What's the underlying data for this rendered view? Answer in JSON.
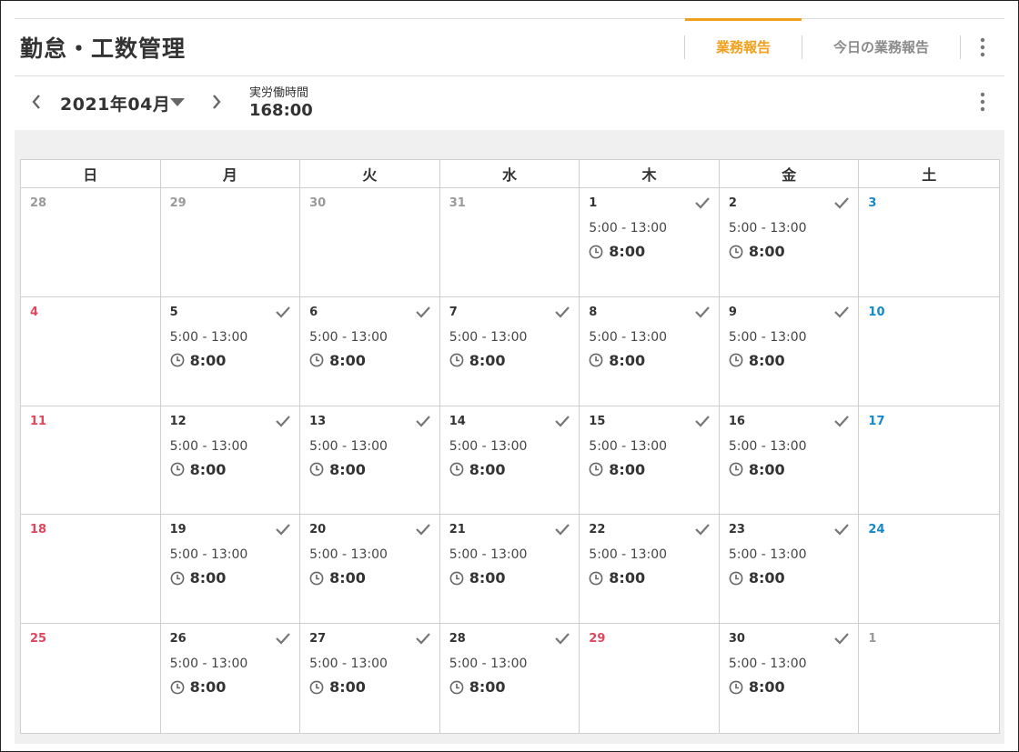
{
  "app": {
    "title": "勤怠・工数管理",
    "tabs": [
      {
        "label": "業務報告",
        "active": true
      },
      {
        "label": "今日の業務報告",
        "active": false
      }
    ]
  },
  "colors": {
    "accent": "#f2a01b",
    "sunday": "#e0465e",
    "saturday": "#1589c7",
    "other_month": "#9a9a9a"
  },
  "toolbar": {
    "month_label": "2021年04月",
    "worked_label": "実労働時間",
    "worked_value": "168:00"
  },
  "icons": {
    "prev": "chevron-left-icon",
    "next": "chevron-right-icon",
    "dropdown": "caret-down-icon",
    "more": "more-vertical-icon",
    "check": "check-icon",
    "clock": "clock-icon"
  },
  "calendar": {
    "weekdays": [
      "日",
      "月",
      "火",
      "水",
      "木",
      "金",
      "土"
    ],
    "days": [
      {
        "day": "28",
        "type": "other"
      },
      {
        "day": "29",
        "type": "other"
      },
      {
        "day": "30",
        "type": "other"
      },
      {
        "day": "31",
        "type": "other"
      },
      {
        "day": "1",
        "type": "cur",
        "done": true,
        "range": "5:00 - 13:00",
        "duration": "8:00"
      },
      {
        "day": "2",
        "type": "cur",
        "done": true,
        "range": "5:00 - 13:00",
        "duration": "8:00"
      },
      {
        "day": "3",
        "type": "sat"
      },
      {
        "day": "4",
        "type": "sun"
      },
      {
        "day": "5",
        "type": "cur",
        "done": true,
        "range": "5:00 - 13:00",
        "duration": "8:00"
      },
      {
        "day": "6",
        "type": "cur",
        "done": true,
        "range": "5:00 - 13:00",
        "duration": "8:00"
      },
      {
        "day": "7",
        "type": "cur",
        "done": true,
        "range": "5:00 - 13:00",
        "duration": "8:00"
      },
      {
        "day": "8",
        "type": "cur",
        "done": true,
        "range": "5:00 - 13:00",
        "duration": "8:00"
      },
      {
        "day": "9",
        "type": "cur",
        "done": true,
        "range": "5:00 - 13:00",
        "duration": "8:00"
      },
      {
        "day": "10",
        "type": "sat"
      },
      {
        "day": "11",
        "type": "sun"
      },
      {
        "day": "12",
        "type": "cur",
        "done": true,
        "range": "5:00 - 13:00",
        "duration": "8:00"
      },
      {
        "day": "13",
        "type": "cur",
        "done": true,
        "range": "5:00 - 13:00",
        "duration": "8:00"
      },
      {
        "day": "14",
        "type": "cur",
        "done": true,
        "range": "5:00 - 13:00",
        "duration": "8:00"
      },
      {
        "day": "15",
        "type": "cur",
        "done": true,
        "range": "5:00 - 13:00",
        "duration": "8:00"
      },
      {
        "day": "16",
        "type": "cur",
        "done": true,
        "range": "5:00 - 13:00",
        "duration": "8:00"
      },
      {
        "day": "17",
        "type": "sat"
      },
      {
        "day": "18",
        "type": "sun"
      },
      {
        "day": "19",
        "type": "cur",
        "done": true,
        "range": "5:00 - 13:00",
        "duration": "8:00"
      },
      {
        "day": "20",
        "type": "cur",
        "done": true,
        "range": "5:00 - 13:00",
        "duration": "8:00"
      },
      {
        "day": "21",
        "type": "cur",
        "done": true,
        "range": "5:00 - 13:00",
        "duration": "8:00"
      },
      {
        "day": "22",
        "type": "cur",
        "done": true,
        "range": "5:00 - 13:00",
        "duration": "8:00"
      },
      {
        "day": "23",
        "type": "cur",
        "done": true,
        "range": "5:00 - 13:00",
        "duration": "8:00"
      },
      {
        "day": "24",
        "type": "sat"
      },
      {
        "day": "25",
        "type": "sun"
      },
      {
        "day": "26",
        "type": "cur",
        "done": true,
        "range": "5:00 - 13:00",
        "duration": "8:00"
      },
      {
        "day": "27",
        "type": "cur",
        "done": true,
        "range": "5:00 - 13:00",
        "duration": "8:00"
      },
      {
        "day": "28",
        "type": "cur",
        "done": true,
        "range": "5:00 - 13:00",
        "duration": "8:00"
      },
      {
        "day": "29",
        "type": "sun"
      },
      {
        "day": "30",
        "type": "cur",
        "done": true,
        "range": "5:00 - 13:00",
        "duration": "8:00"
      },
      {
        "day": "1",
        "type": "other"
      }
    ]
  }
}
